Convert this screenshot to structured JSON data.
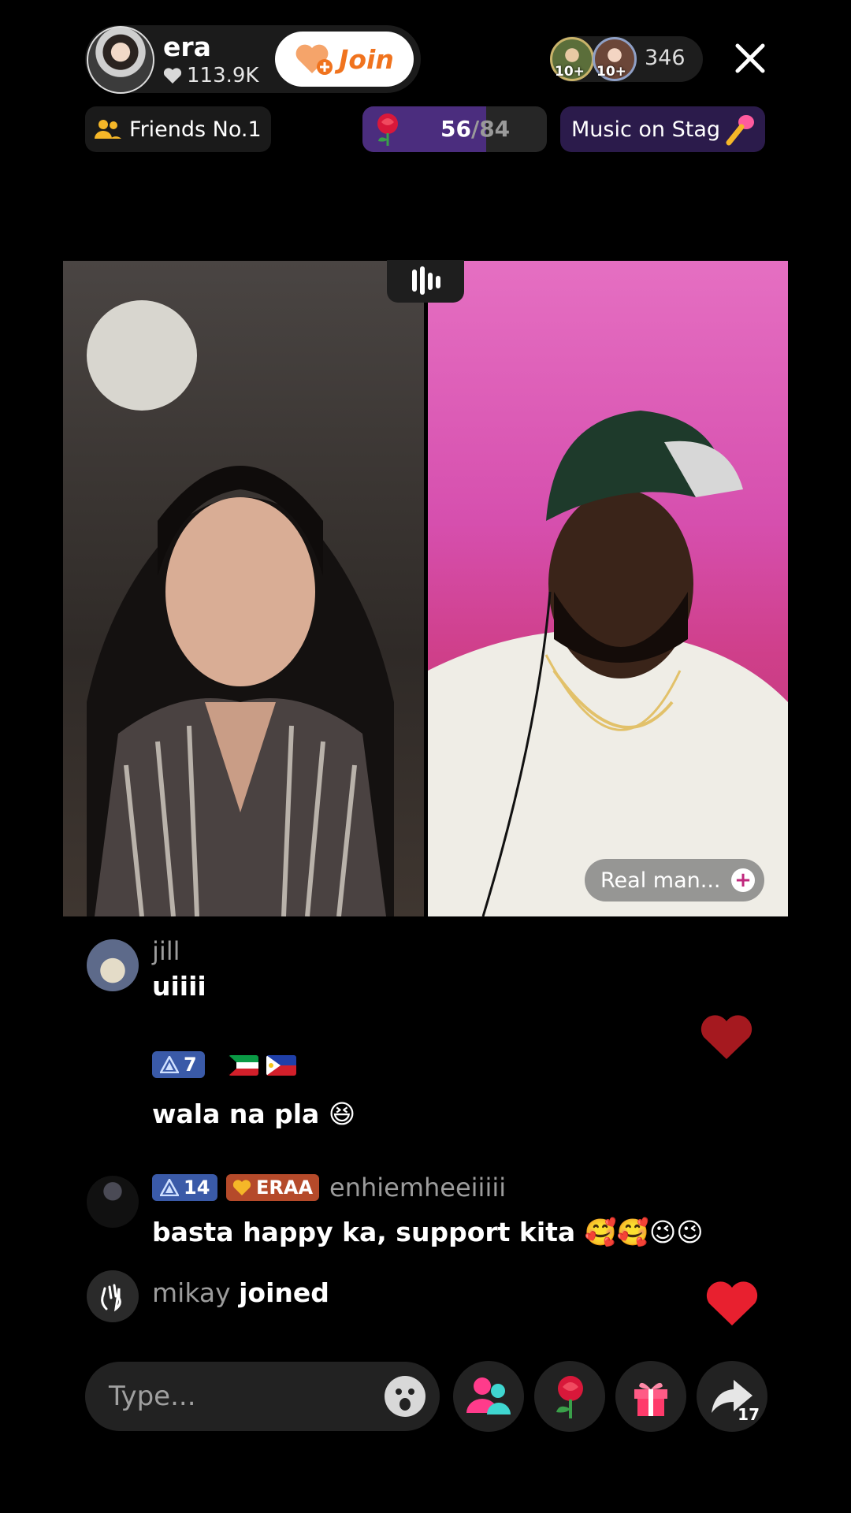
{
  "host": {
    "name": "era",
    "likes": "113.9K",
    "join_label": "Join"
  },
  "viewers": {
    "badge_1": "10+",
    "badge_2": "10+",
    "count": "346"
  },
  "row2": {
    "friends_label": "Friends No.1",
    "rose_count": "56",
    "rose_total": "/84",
    "rose_progress": 0.67,
    "music_label": "Music on Stag"
  },
  "video": {
    "right_tag": "Real man..."
  },
  "chat": [
    {
      "username": "jill",
      "message": "uiiii"
    },
    {
      "level": "7",
      "message": "wala na pla 😆"
    },
    {
      "level": "14",
      "fan_badge": "ERAA",
      "username": "enhiemheeiiiii",
      "message": "basta happy ka, support kita 🥰🥰😉😉"
    },
    {
      "username": "mikay",
      "action": "joined"
    }
  ],
  "input": {
    "placeholder": "Type..."
  },
  "share": {
    "count": "17"
  },
  "colors": {
    "accent": "#f0731e",
    "like_red": "#e8202f",
    "rose_purple": "#4b2d7e"
  }
}
